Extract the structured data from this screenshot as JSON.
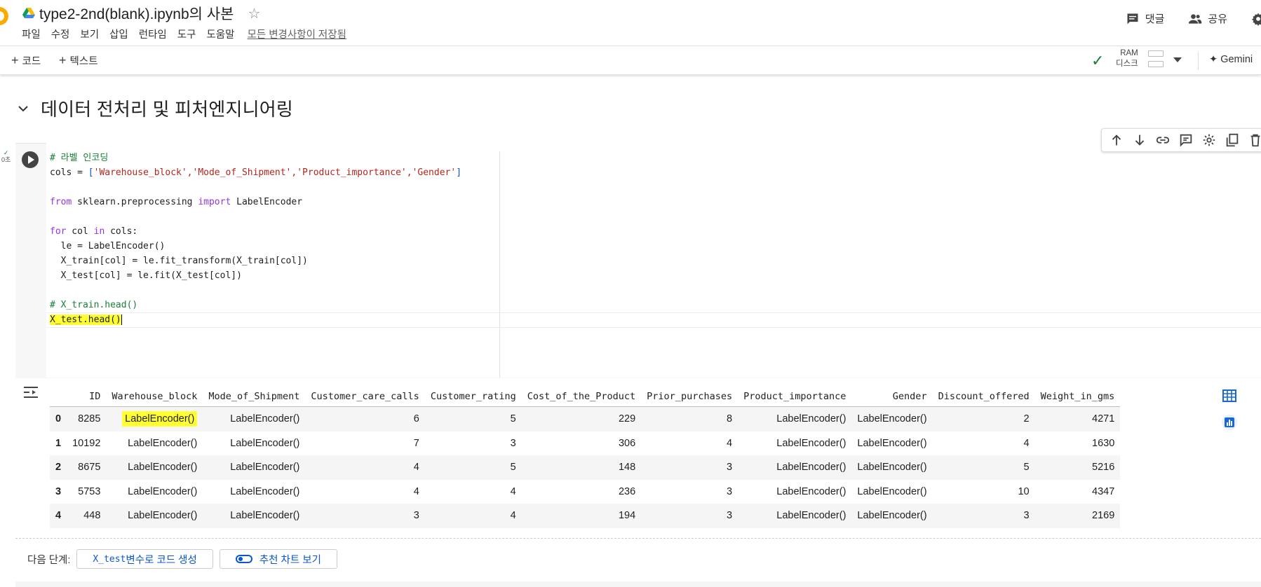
{
  "header": {
    "title": "type2-2nd(blank).ipynb의 사본",
    "menu": [
      "파일",
      "수정",
      "보기",
      "삽입",
      "런타임",
      "도구",
      "도움말"
    ],
    "save_status": "모든 변경사항이 저장됨",
    "comment_label": "댓글",
    "share_label": "공유"
  },
  "toolbar": {
    "add_code": "코드",
    "add_text": "텍스트",
    "ram_label": "RAM",
    "disk_label": "디스크",
    "gemini_label": "Gemini"
  },
  "section": {
    "title": "데이터 전처리 및 피처엔지니어링"
  },
  "cell": {
    "exec_time": "0초",
    "code": {
      "l1": "# 라벨 인코딩",
      "cols_prefix": "cols = ",
      "cols_list": "'Warehouse_block','Mode_of_Shipment','Product_importance','Gender'",
      "from_kw": "from",
      "module": " sklearn.preprocessing ",
      "import_kw": "import",
      "cls": " LabelEncoder",
      "for_kw": "for",
      "loop_var": " col ",
      "in_kw": "in",
      "loop_iter": " cols:",
      "le_line": "  le = LabelEncoder()",
      "train_line": "  X_train[col] = le.fit_transform(X_train[col])",
      "test_line": "  X_test[col] = le.fit(X_test[col])",
      "comment2": "# X_train.head()",
      "last_line": "X_test.head()"
    }
  },
  "output": {
    "columns": [
      "",
      "ID",
      "Warehouse_block",
      "Mode_of_Shipment",
      "Customer_care_calls",
      "Customer_rating",
      "Cost_of_the_Product",
      "Prior_purchases",
      "Product_importance",
      "Gender",
      "Discount_offered",
      "Weight_in_gms"
    ],
    "rows": [
      [
        "0",
        "8285",
        "LabelEncoder()",
        "LabelEncoder()",
        "6",
        "5",
        "229",
        "8",
        "LabelEncoder()",
        "LabelEncoder()",
        "2",
        "4271"
      ],
      [
        "1",
        "10192",
        "LabelEncoder()",
        "LabelEncoder()",
        "7",
        "3",
        "306",
        "4",
        "LabelEncoder()",
        "LabelEncoder()",
        "4",
        "1630"
      ],
      [
        "2",
        "8675",
        "LabelEncoder()",
        "LabelEncoder()",
        "4",
        "5",
        "148",
        "3",
        "LabelEncoder()",
        "LabelEncoder()",
        "5",
        "5216"
      ],
      [
        "3",
        "5753",
        "LabelEncoder()",
        "LabelEncoder()",
        "4",
        "4",
        "236",
        "3",
        "LabelEncoder()",
        "LabelEncoder()",
        "10",
        "4347"
      ],
      [
        "4",
        "448",
        "LabelEncoder()",
        "LabelEncoder()",
        "3",
        "4",
        "194",
        "3",
        "LabelEncoder()",
        "LabelEncoder()",
        "3",
        "2169"
      ]
    ],
    "next_steps_label": "다음 단계:",
    "suggest_code_var": "X_test",
    "suggest_code_text": " 변수로 코드 생성",
    "suggest_chart": "추천 차트 보기"
  },
  "colors": {
    "highlight": "#ffff33",
    "accent": "#0b57d0",
    "ok": "#188038"
  }
}
